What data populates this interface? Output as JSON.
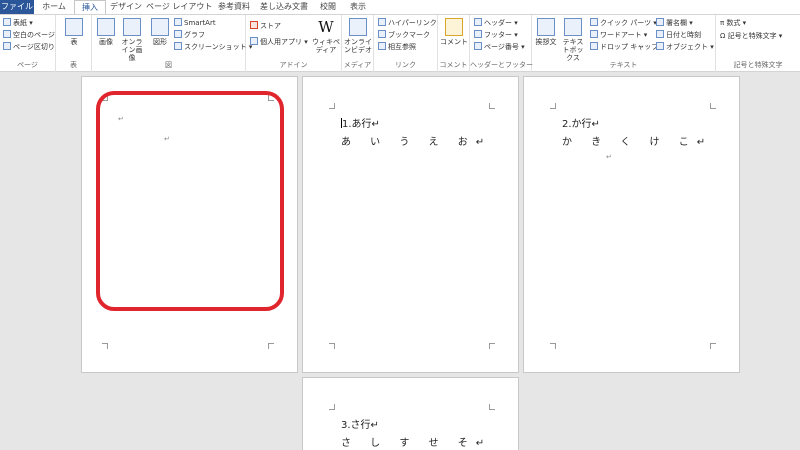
{
  "tabs": [
    "ファイル",
    "ホーム",
    "挿入",
    "デザイン",
    "ページ レイアウト",
    "参考資料",
    "差し込み文書",
    "校閲",
    "表示"
  ],
  "ribbon": {
    "page_group": {
      "label": "ページ",
      "items": [
        "表紙 ▾",
        "空白のページ",
        "ページ区切り"
      ]
    },
    "table_group": {
      "label": "表",
      "button": "表"
    },
    "figure_group": {
      "label": "図",
      "buttons": [
        "画像",
        "オンライン画像",
        "図形"
      ],
      "items": [
        "SmartArt",
        "グラフ",
        "スクリーンショット ▾"
      ]
    },
    "addin_group": {
      "label": "アドイン",
      "items": [
        "ストア",
        "個人用アプリ ▾"
      ],
      "button": "ウィキペディア"
    },
    "media_group": {
      "label": "メディア",
      "button": "オンラインビデオ"
    },
    "link_group": {
      "label": "リンク",
      "items": [
        "ハイパーリンク",
        "ブックマーク",
        "相互参照"
      ]
    },
    "comment_group": {
      "label": "コメント",
      "button": "コメント"
    },
    "header_footer_group": {
      "label": "ヘッダーとフッター",
      "items": [
        "ヘッダー ▾",
        "フッター ▾",
        "ページ番号 ▾"
      ]
    },
    "text_group": {
      "label": "テキスト",
      "buttons": [
        "挨拶文",
        "テキストボックス"
      ],
      "items": [
        "クイック パーツ ▾",
        "ワードアート ▾",
        "ドロップ キャップ ▾",
        "署名欄 ▾",
        "日付と時刻",
        "オブジェクト ▾"
      ]
    },
    "symbol_group": {
      "label": "記号と特殊文字",
      "items": [
        "π 数式 ▾",
        "Ω 記号と特殊文字 ▾"
      ]
    }
  },
  "pages": [
    {
      "lines": []
    },
    {
      "lines": [
        "1.あ行↵",
        "あ い う え お↵"
      ]
    },
    {
      "lines": [
        "2.か行↵",
        "か き く け こ↵"
      ]
    },
    {
      "lines": [
        "3.さ行↵",
        "さ し す せ そ↵"
      ]
    }
  ],
  "return_mark": "↵",
  "colors": {
    "file_tab": "#2b579a",
    "highlight": "#e0262c"
  }
}
